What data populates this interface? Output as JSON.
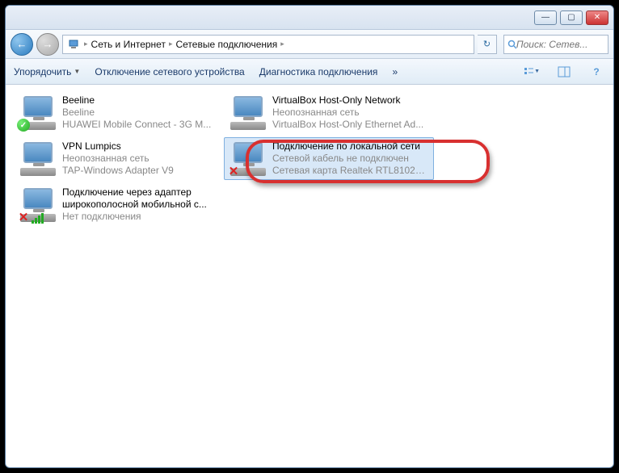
{
  "titlebar": {
    "min": "—",
    "max": "▢",
    "close": "✕"
  },
  "nav": {
    "back": "←",
    "forward": "→",
    "crumb1": "Сеть и Интернет",
    "crumb2": "Сетевые подключения",
    "sep": "▸",
    "refresh": "↻",
    "search_placeholder": "Поиск: Сетев..."
  },
  "toolbar": {
    "organize": "Упорядочить",
    "disable": "Отключение сетевого устройства",
    "diag": "Диагностика подключения",
    "more": "»"
  },
  "connections": [
    {
      "title": "Beeline",
      "sub1": "Beeline",
      "sub2": "HUAWEI Mobile Connect - 3G M...",
      "status": "ok"
    },
    {
      "title": "VirtualBox Host-Only Network",
      "sub1": "Неопознанная сеть",
      "sub2": "VirtualBox Host-Only Ethernet Ad...",
      "status": "none"
    },
    {
      "title": "VPN Lumpics",
      "sub1": "Неопознанная сеть",
      "sub2": "TAP-Windows Adapter V9",
      "status": "none"
    },
    {
      "title": "Подключение по локальной сети",
      "sub1": "Сетевой кабель не подключен",
      "sub2": "Сетевая карта Realtek RTL8102E/...",
      "status": "x",
      "selected": true
    },
    {
      "title": "Подключение через адаптер широкополосной мобильной с...",
      "sub1": "Нет подключения",
      "sub2": "",
      "status": "signal-x"
    }
  ]
}
